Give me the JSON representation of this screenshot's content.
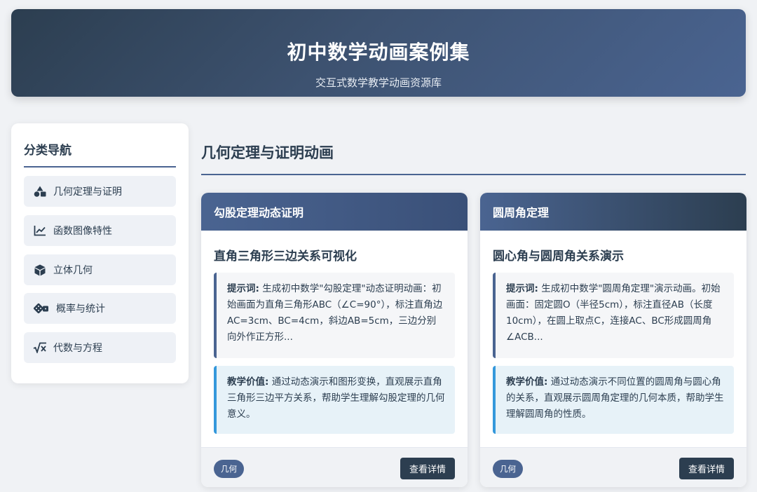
{
  "header": {
    "title": "初中数学动画案例集",
    "subtitle": "交互式数学教学动画资源库"
  },
  "sidebar": {
    "title": "分类导航",
    "items": [
      {
        "label": "几何定理与证明",
        "icon": "shapes-icon"
      },
      {
        "label": "函数图像特性",
        "icon": "line-chart-icon"
      },
      {
        "label": "立体几何",
        "icon": "cube-icon"
      },
      {
        "label": "概率与统计",
        "icon": "dice-icon"
      },
      {
        "label": "代数与方程",
        "icon": "square-root-icon"
      }
    ]
  },
  "main": {
    "section_title": "几何定理与证明动画",
    "cards": [
      {
        "header": "勾股定理动态证明",
        "subtitle": "直角三角形三边关系可视化",
        "prompt_label": "提示词:",
        "prompt_text": "生成初中数学\"勾股定理\"动态证明动画：初始画面为直角三角形ABC（∠C=90°），标注直角边AC=3cm、BC=4cm，斜边AB=5cm，三边分别向外作正方形...",
        "value_label": "教学价值:",
        "value_text": "通过动态演示和图形变换，直观展示直角三角形三边平方关系，帮助学生理解勾股定理的几何意义。",
        "tag": "几何",
        "button": "查看详情"
      },
      {
        "header": "圆周角定理",
        "subtitle": "圆心角与圆周角关系演示",
        "prompt_label": "提示词:",
        "prompt_text": "生成初中数学\"圆周角定理\"演示动画。初始画面：固定圆O（半径5cm），标注直径AB（长度10cm），在圆上取点C，连接AC、BC形成圆周角∠ACB...",
        "value_label": "教学价值:",
        "value_text": "通过动态演示不同位置的圆周角与圆心角的关系，直观展示圆周角定理的几何本质，帮助学生理解圆周角的性质。",
        "tag": "几何",
        "button": "查看详情"
      }
    ]
  },
  "colors": {
    "primary_dark": "#2c3e50",
    "primary": "#4a6491",
    "accent_blue": "#3498db",
    "background": "#f0f2f5"
  }
}
